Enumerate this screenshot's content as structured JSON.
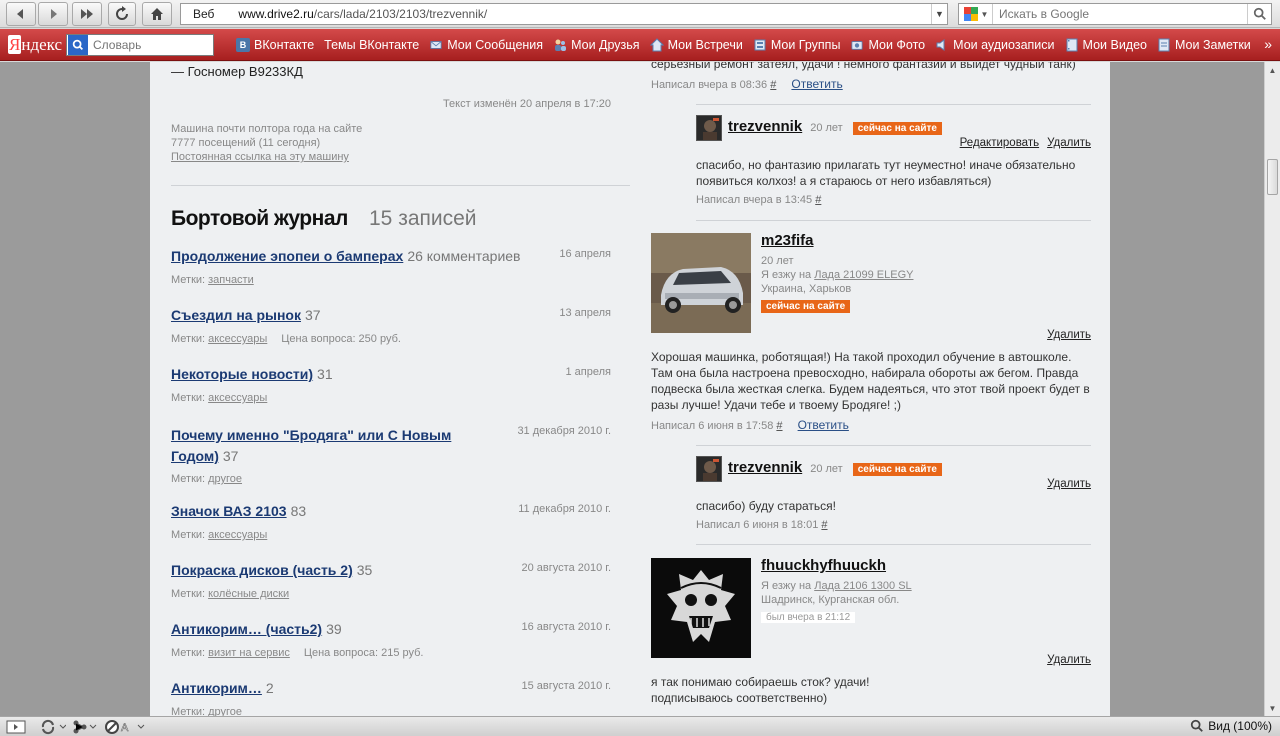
{
  "toolbar": {
    "url_proto": "Веб",
    "url_host": "www.drive2.ru",
    "url_path": "/cars/lada/2103/2103/trezvennik/",
    "search_placeholder": "Искать в Google"
  },
  "yandex_bar": {
    "logo_first": "Я",
    "logo_rest": "ндекс",
    "search_placeholder": "Словарь",
    "items": [
      {
        "label": "ВКонтакте"
      },
      {
        "label": "Темы ВКонтакте"
      },
      {
        "label": "Мои Сообщения"
      },
      {
        "label": "Мои Друзья"
      },
      {
        "label": "Мои Встречи"
      },
      {
        "label": "Мои Группы"
      },
      {
        "label": "Мои Фото"
      },
      {
        "label": "Мои аудиозаписи"
      },
      {
        "label": "Мои Видео"
      },
      {
        "label": "Мои Заметки"
      }
    ]
  },
  "car": {
    "gosnomer": "— Госномер В9233КД",
    "edited": "Текст изменён 20 апреля в 17:20",
    "stats_line1": "Машина почти полтора года на сайте",
    "stats_line2": "7777 посещений (11 сегодня)",
    "permalink": "Постоянная ссылка на эту машину"
  },
  "journal": {
    "title": "Бортовой журнал",
    "count": "15 записей",
    "tags_label": "Метки:",
    "entries": [
      {
        "title": "Продолжение эпопеи о бамперах",
        "count": "26 комментариев",
        "date": "16 апреля",
        "tag": "запчасти",
        "price": ""
      },
      {
        "title": "Съездил на рынок",
        "count": "37",
        "date": "13 апреля",
        "tag": "аксессуары",
        "price": "Цена вопроса: 250 руб."
      },
      {
        "title": "Некоторые новости)",
        "count": "31",
        "date": "1 апреля",
        "tag": "аксессуары",
        "price": ""
      },
      {
        "title": "Почему именно \"Бродяга\" или С Новым Годом)",
        "count": "37",
        "date": "31 декабря 2010 г.",
        "tag": "другое",
        "price": ""
      },
      {
        "title": "Значок ВАЗ 2103",
        "count": "83",
        "date": "11 декабря 2010 г.",
        "tag": "аксессуары",
        "price": ""
      },
      {
        "title": "Покраска дисков (часть 2)",
        "count": "35",
        "date": "20 августа 2010 г.",
        "tag": "колёсные диски",
        "price": ""
      },
      {
        "title": "Антикорим… (часть2)",
        "count": "39",
        "date": "16 августа 2010 г.",
        "tag": "визит на сервис",
        "price": "Цена вопроса: 215 руб."
      },
      {
        "title": "Антикорим…",
        "count": "2",
        "date": "15 августа 2010 г.",
        "tag": "другое",
        "price": ""
      }
    ]
  },
  "comments": {
    "top_text_tail": "серьезный ремонт затеял, удачи ! немного фантазии и выйдет чудный танк)",
    "top_meta": "Написал вчера в 08:36",
    "hash": "#",
    "reply_label": "Ответить",
    "edit_label": "Редактировать",
    "delete_label": "Удалить",
    "online_label": "сейчас на сайте",
    "reply1": {
      "user": "trezvennik",
      "age": "20 лет",
      "text": "спасибо, но фантазию прилагать тут неуместно! иначе обязательно появиться колхоз! а я стараюсь от него избавляться)",
      "meta": "Написал вчера в 13:45"
    },
    "c2": {
      "user": "m23fifa",
      "age": "20 лет",
      "drives_prefix": "Я езжу на",
      "drives_car": "Лада 21099 ELEGY",
      "location": "Украина, Харьков",
      "text": "Хорошая машинка, роботящая!) На такой проходил обучение в автошколе. Там она была настроена превосходно, набирала обороты аж бегом. Правда подвеска была жесткая слегка. Будем надеяться, что этот твой проект будет в разы лучше! Удачи тебе и твоему Бродяге! ;)",
      "meta": "Написал 6 июня в 17:58"
    },
    "reply2": {
      "user": "trezvennik",
      "age": "20 лет",
      "text": "спасибо) буду стараться!",
      "meta": "Написал 6 июня в 18:01"
    },
    "c3": {
      "user": "fhuuckhyfhuuckh",
      "drives_prefix": "Я езжу на",
      "drives_car": "Лада 2106 1300 SL",
      "location": "Шадринск, Курганская обл.",
      "last_seen": "был вчера в 21:12",
      "text_line1": "я так понимаю собираешь сток? удачи!",
      "text_line2": "подписываюсь соответственно)"
    }
  },
  "statusbar": {
    "zoom_label": "Вид (100%)"
  }
}
